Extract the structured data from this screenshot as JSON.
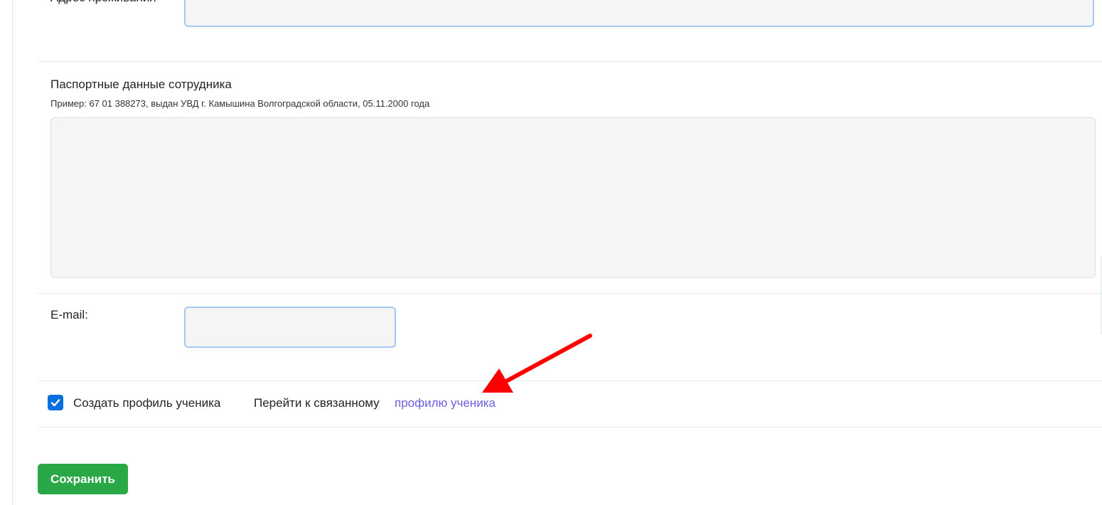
{
  "form": {
    "address": {
      "label": "Адрес проживания",
      "value": ""
    },
    "passport": {
      "label": "Паспортные данные сотрудника",
      "hint": "Пример: 67 01 388273, выдан УВД г. Камышина Волгоградской области, 05.11.2000 года",
      "value": ""
    },
    "email": {
      "label": "E-mail:",
      "value": ""
    },
    "create_student_profile": {
      "label": "Создать профиль ученика",
      "checked": true
    },
    "linked_profile": {
      "prefix": "Перейти к связанному",
      "link_text": "профилю ученика"
    },
    "save_label": "Сохранить"
  },
  "colors": {
    "accent": "#0b6fe0",
    "link": "#6a5fe0",
    "save_button": "#2aa747",
    "annotation_arrow": "#ff0000",
    "input_focus_border": "#a9c8f0"
  },
  "icons": {
    "checkbox": "check-icon",
    "annotation": "red-arrow-icon",
    "resize": "resize-grip-icon"
  }
}
